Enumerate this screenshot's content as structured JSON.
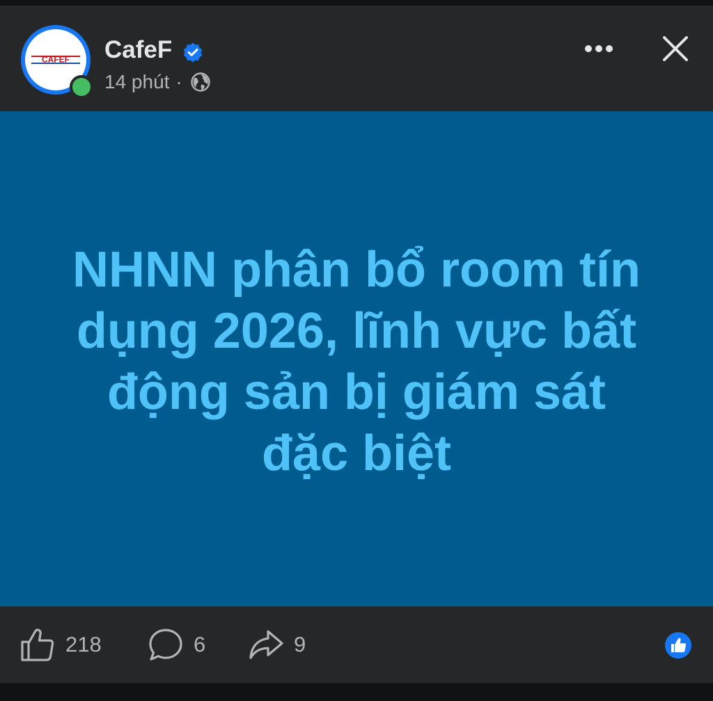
{
  "post": {
    "page_name": "CafeF",
    "time": "14 phút",
    "separator": "·",
    "avatar_logo_text": "CAFEF",
    "text_line_1": "NHNN phân bổ room tín",
    "text_line_2": "dụng 2026, lĩnh vực bất",
    "text_line_3": "động sản bị giám sát",
    "text_line_4": "đặc biệt",
    "background_color": "#005b8f",
    "text_color": "#4fc3f7"
  },
  "footer": {
    "likes": "218",
    "comments": "6",
    "shares": "9"
  },
  "icons": {
    "verified": "verified-badge-icon",
    "privacy": "globe-icon",
    "more": "more-options-icon",
    "close": "close-icon",
    "like": "thumbs-up-icon",
    "comment": "comment-bubble-icon",
    "share": "share-arrow-icon",
    "reaction": "like-reaction-icon"
  }
}
